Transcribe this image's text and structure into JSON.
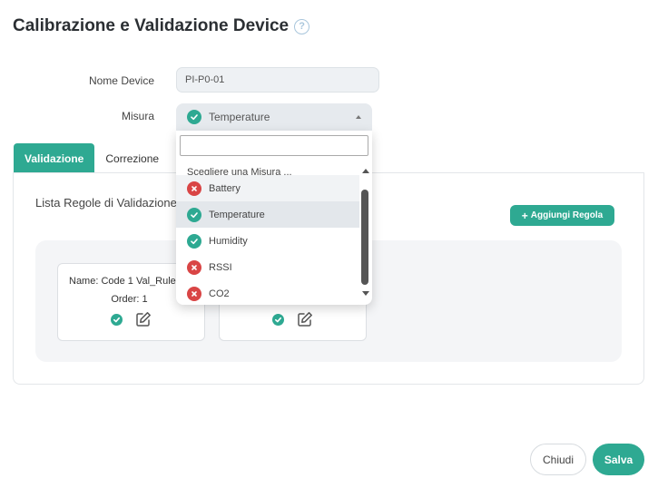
{
  "header": {
    "title": "Calibrazione e Validazione Device",
    "help_icon": "question-circle-icon",
    "help_symbol": "?"
  },
  "form": {
    "name_label": "Nome Device",
    "name_value": "PI-P0-01",
    "misura_label": "Misura",
    "misura_selected": "Temperature"
  },
  "tabs": [
    {
      "label": "Validazione",
      "active": true
    },
    {
      "label": "Correzione",
      "active": false
    }
  ],
  "panel": {
    "list_title": "Lista Regole di Validazione",
    "add_button": "Aggiungi Regola",
    "add_symbol": "+"
  },
  "cards": [
    {
      "name": "Name: Code 1 Val_Rule",
      "order": "Order: 1"
    },
    {
      "name": "",
      "order": ""
    }
  ],
  "dropdown": {
    "search_value": "",
    "placeholder": "Scegliere una Misura ...",
    "items": [
      {
        "label": "Battery",
        "status": "invalid"
      },
      {
        "label": "Temperature",
        "status": "valid"
      },
      {
        "label": "Humidity",
        "status": "valid"
      },
      {
        "label": "RSSI",
        "status": "invalid"
      },
      {
        "label": "CO2",
        "status": "invalid"
      }
    ]
  },
  "footer": {
    "close_label": "Chiudi",
    "save_label": "Salva"
  },
  "colors": {
    "accent": "#2ea992",
    "error": "#d94545"
  }
}
